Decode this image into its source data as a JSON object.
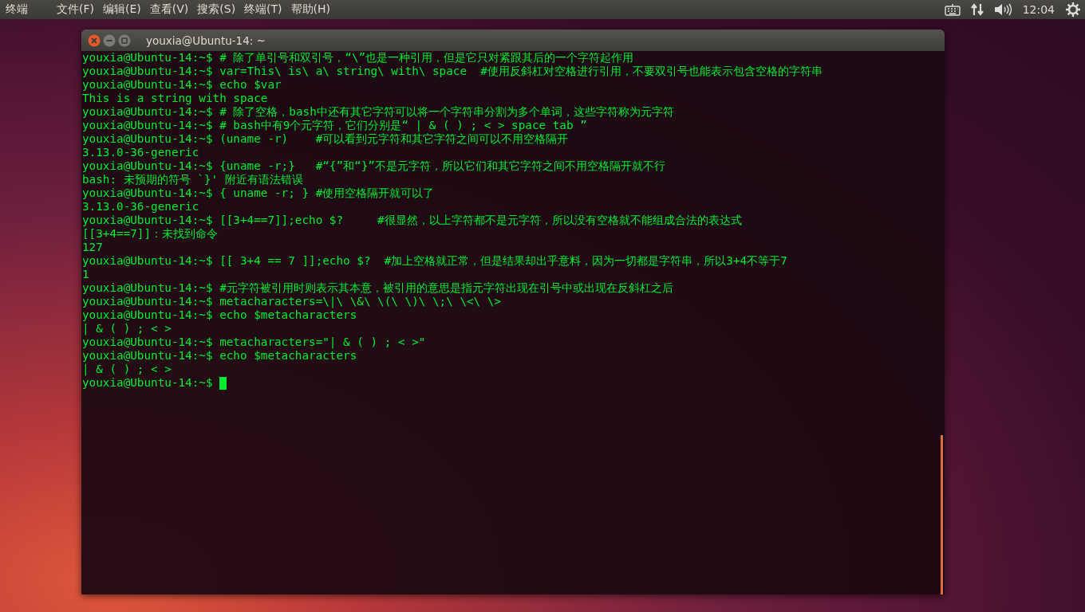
{
  "top_bar": {
    "app_name": "终端",
    "menus": [
      "文件(F)",
      "编辑(E)",
      "查看(V)",
      "搜索(S)",
      "终端(T)",
      "帮助(H)"
    ],
    "clock": "12:04"
  },
  "window": {
    "title": "youxia@Ubuntu-14: ~"
  },
  "terminal": {
    "lines": [
      "youxia@Ubuntu-14:~$ # 除了单引号和双引号，“\\”也是一种引用，但是它只对紧跟其后的一个字符起作用",
      "youxia@Ubuntu-14:~$ var=This\\ is\\ a\\ string\\ with\\ space  #使用反斜杠对空格进行引用，不要双引号也能表示包含空格的字符串",
      "youxia@Ubuntu-14:~$ echo $var",
      "This is a string with space",
      "youxia@Ubuntu-14:~$ # 除了空格，bash中还有其它字符可以将一个字符串分割为多个单词，这些字符称为元字符",
      "youxia@Ubuntu-14:~$ # bash中有9个元字符，它们分别是“ | & ( ) ; < > space tab ”",
      "youxia@Ubuntu-14:~$ (uname -r)    #可以看到元字符和其它字符之间可以不用空格隔开",
      "3.13.0-36-generic",
      "youxia@Ubuntu-14:~$ {uname -r;}   #“{”和“}”不是元字符，所以它们和其它字符之间不用空格隔开就不行",
      "bash: 未预期的符号 `}' 附近有语法错误",
      "youxia@Ubuntu-14:~$ { uname -r; } #使用空格隔开就可以了",
      "3.13.0-36-generic",
      "youxia@Ubuntu-14:~$ [[3+4==7]];echo $?     #很显然，以上字符都不是元字符，所以没有空格就不能组成合法的表达式",
      "[[3+4==7]]：未找到命令",
      "127",
      "youxia@Ubuntu-14:~$ [[ 3+4 == 7 ]];echo $?  #加上空格就正常，但是结果却出乎意料，因为一切都是字符串，所以3+4不等于7",
      "1",
      "youxia@Ubuntu-14:~$ #元字符被引用时则表示其本意，被引用的意思是指元字符出现在引号中或出现在反斜杠之后",
      "youxia@Ubuntu-14:~$ metacharacters=\\|\\ \\&\\ \\(\\ \\)\\ \\;\\ \\<\\ \\>",
      "youxia@Ubuntu-14:~$ echo $metacharacters",
      "| & ( ) ; < >",
      "youxia@Ubuntu-14:~$ metacharacters=\"| & ( ) ; < >\"",
      "youxia@Ubuntu-14:~$ echo $metacharacters",
      "| & ( ) ; < >",
      "youxia@Ubuntu-14:~$ "
    ],
    "cursor_visible": true
  }
}
